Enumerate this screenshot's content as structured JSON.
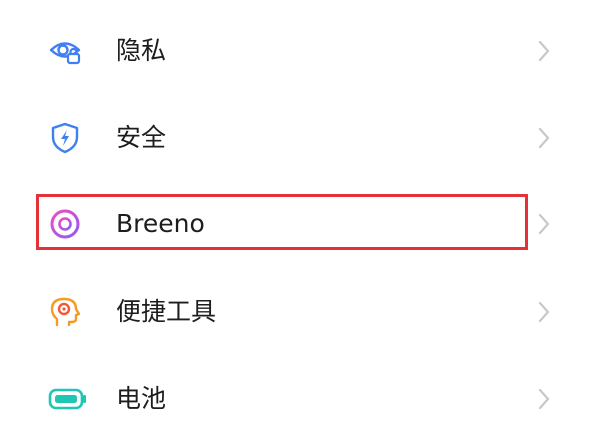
{
  "settings": {
    "items": [
      {
        "label": "隐私",
        "icon": "privacy-eye-lock-icon"
      },
      {
        "label": "安全",
        "icon": "security-shield-icon"
      },
      {
        "label": "Breeno",
        "icon": "breeno-ring-icon"
      },
      {
        "label": "便捷工具",
        "icon": "convenience-tools-head-icon"
      },
      {
        "label": "电池",
        "icon": "battery-icon"
      }
    ],
    "highlighted_item": "Breeno"
  },
  "colors": {
    "privacy_icon": "#3f7ff0",
    "security_icon": "#3f7ff0",
    "breeno_icon_gradient": [
      "#f04cc0",
      "#8f5cf5"
    ],
    "tools_icon": "#f59a23",
    "battery_icon": "#1fc7b2",
    "chevron": "#c8c8c8",
    "highlight_border": "#e53238"
  }
}
